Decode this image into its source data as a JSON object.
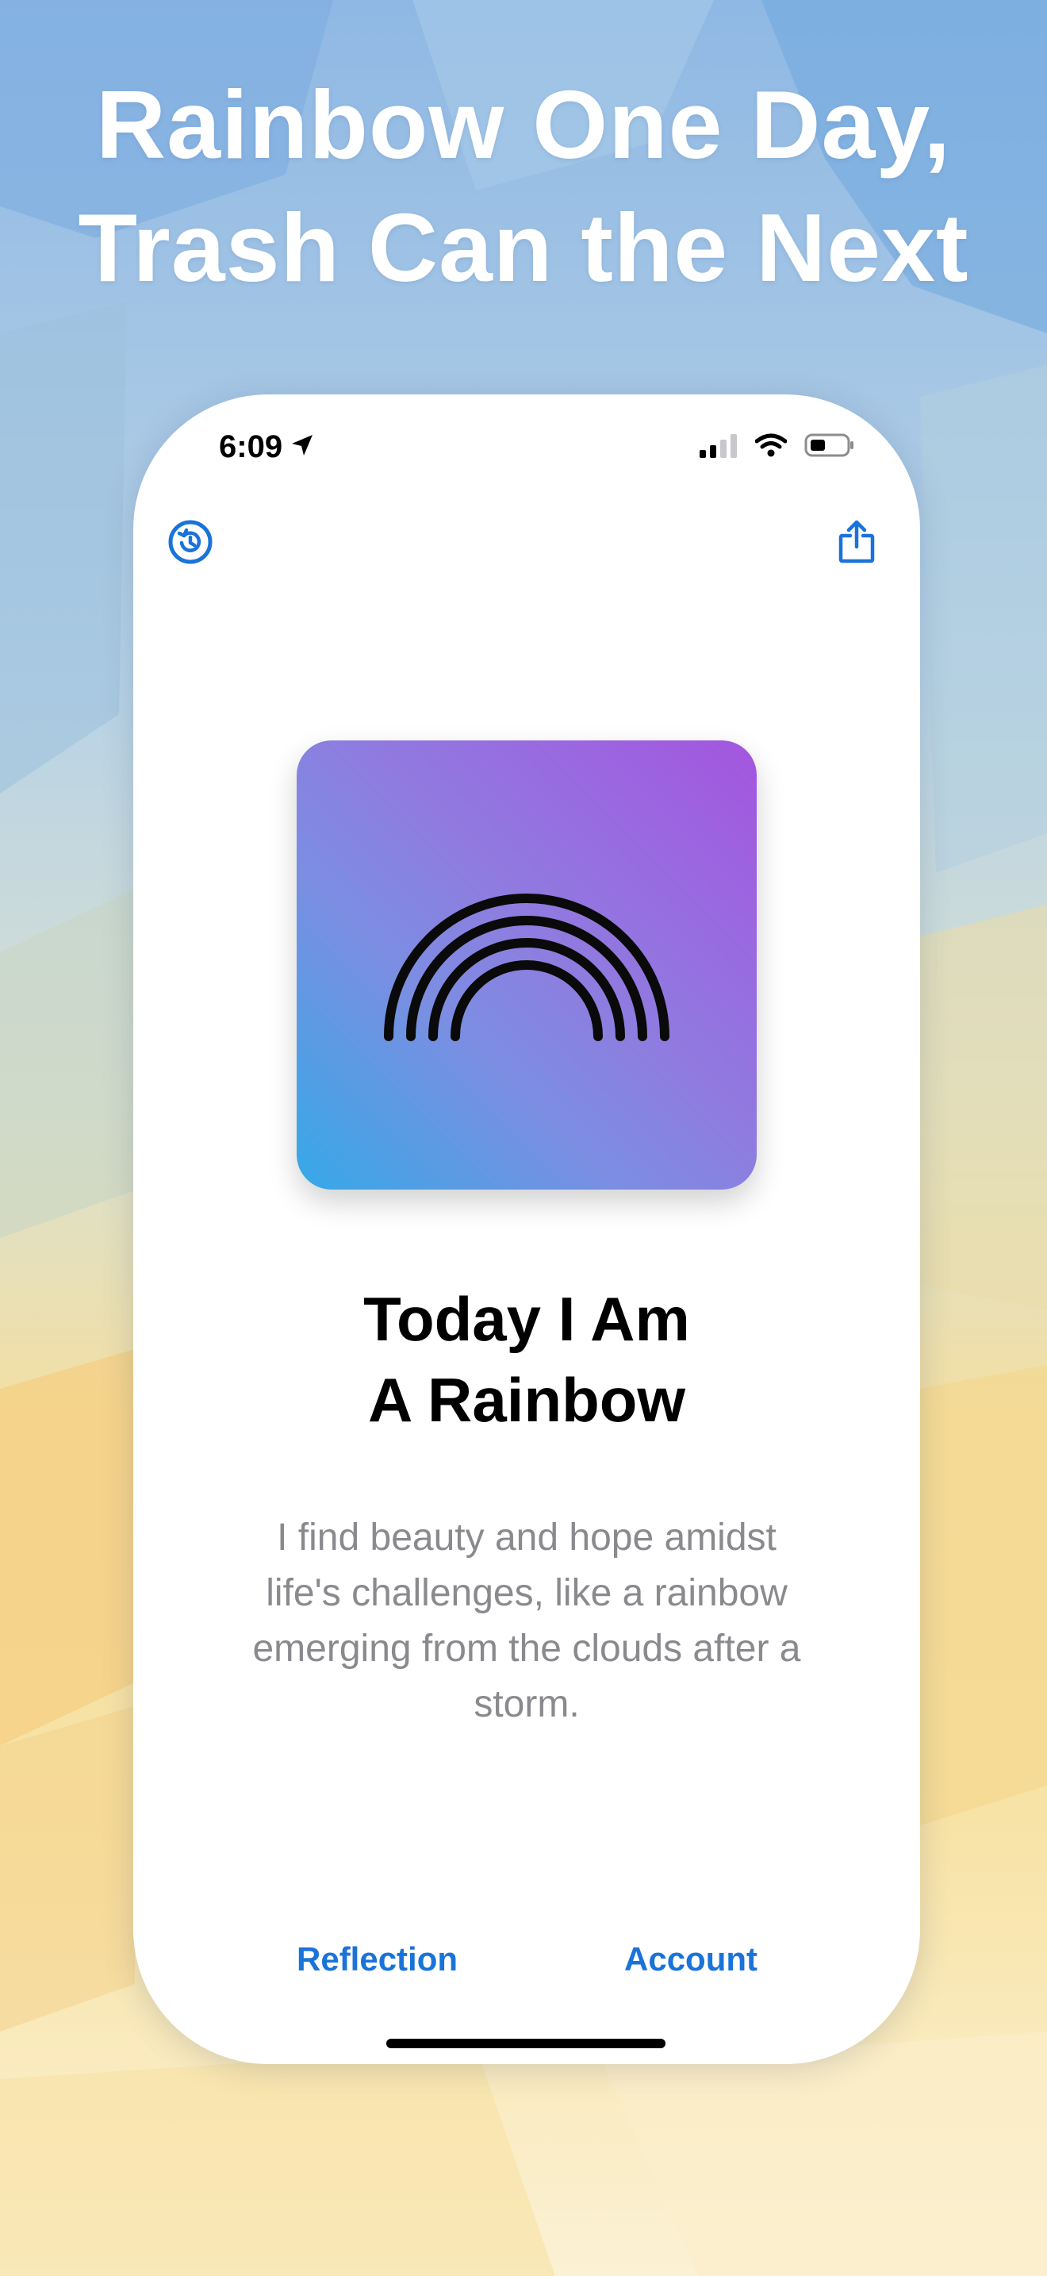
{
  "headline": {
    "line1": "Rainbow One Day,",
    "line2": "Trash Can the Next"
  },
  "status_bar": {
    "time": "6:09",
    "icons": [
      "location-arrow-icon",
      "cellular-signal-icon",
      "wifi-icon",
      "battery-icon"
    ]
  },
  "nav": {
    "left_icon": "history-clock-icon",
    "right_icon": "share-icon"
  },
  "app_icon": {
    "icon": "rainbow-arches-icon",
    "gradient": [
      "#a455df",
      "#7b8ee2",
      "#35a9e7"
    ]
  },
  "main": {
    "title_line1": "Today I Am",
    "title_line2": "A Rainbow",
    "description_lines": [
      "I find beauty and hope amidst",
      "life's challenges, like a rainbow",
      "emerging from the clouds after a",
      "storm."
    ]
  },
  "tabs": [
    {
      "label": "Reflection"
    },
    {
      "label": "Account"
    }
  ],
  "colors": {
    "accent": "#1a73d9",
    "title": "#000000",
    "description": "#8a8a8e"
  }
}
